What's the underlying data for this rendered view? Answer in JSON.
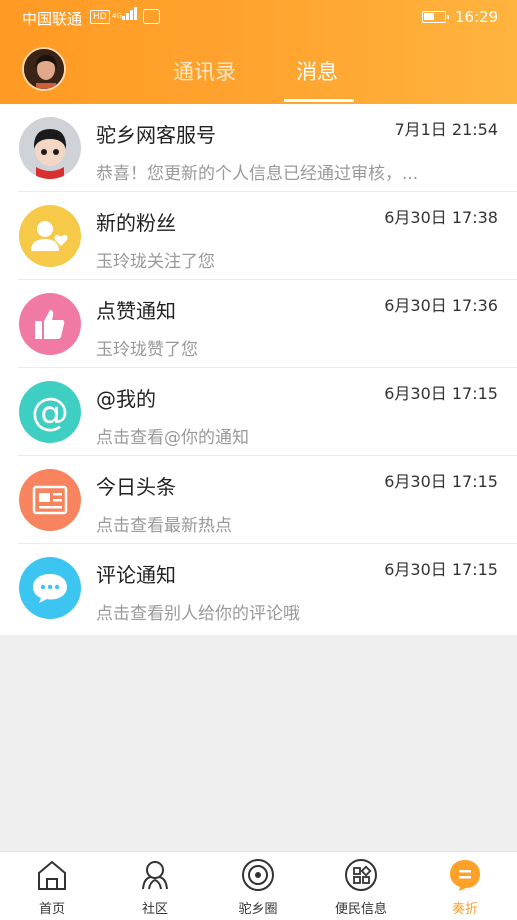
{
  "status_bar": {
    "carrier": "中国联通",
    "hd": "HD",
    "network": "4G",
    "time": "16:29"
  },
  "header": {
    "tabs": [
      {
        "label": "通讯录",
        "active": false
      },
      {
        "label": "消息",
        "active": true
      }
    ]
  },
  "messages": [
    {
      "title": "驼乡网客服号",
      "time": "7月1日 21:54",
      "subtitle": "恭喜！您更新的个人信息已经通过审核，...",
      "icon": "customer-service-avatar-icon"
    },
    {
      "title": "新的粉丝",
      "time": "6月30日 17:38",
      "subtitle": "玉玲珑关注了您",
      "icon": "user-heart-icon",
      "color": "#f7c948"
    },
    {
      "title": "点赞通知",
      "time": "6月30日 17:36",
      "subtitle": "玉玲珑赞了您",
      "icon": "thumbs-up-icon",
      "color": "#f07aa3"
    },
    {
      "title": "@我的",
      "time": "6月30日 17:15",
      "subtitle": "点击查看@你的通知",
      "icon": "at-sign-icon",
      "color": "#3fcfc2"
    },
    {
      "title": "今日头条",
      "time": "6月30日 17:15",
      "subtitle": "点击查看最新热点",
      "icon": "newspaper-icon",
      "color": "#f7845e"
    },
    {
      "title": "评论通知",
      "time": "6月30日 17:15",
      "subtitle": "点击查看别人给你的评论哦",
      "icon": "comment-bubble-icon",
      "color": "#3cc5f0"
    }
  ],
  "tabbar": [
    {
      "label": "首页",
      "icon": "home-icon",
      "active": false
    },
    {
      "label": "社区",
      "icon": "community-icon",
      "active": false
    },
    {
      "label": "驼乡圈",
      "icon": "circle-icon",
      "active": false
    },
    {
      "label": "便民信息",
      "icon": "grid-icon",
      "active": false
    },
    {
      "label": "奏折",
      "icon": "memo-icon",
      "active": true
    }
  ],
  "colors": {
    "accent": "#ff9d2a",
    "header_start": "#ff9a24",
    "header_end": "#ffb43e"
  }
}
